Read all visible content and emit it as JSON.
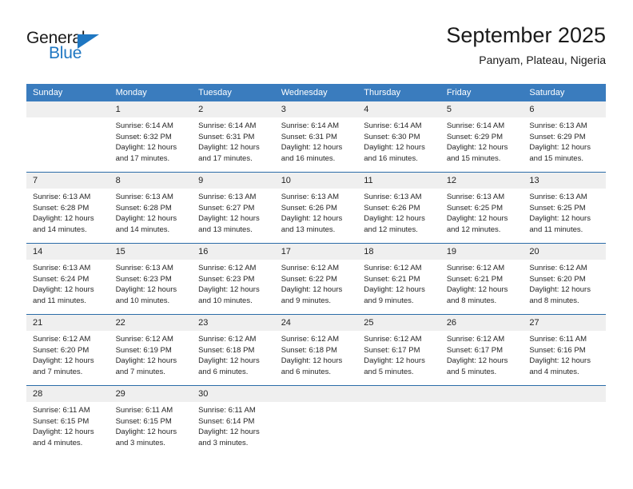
{
  "brand": {
    "name_part1": "General",
    "name_part2": "Blue"
  },
  "header": {
    "title": "September 2025",
    "location": "Panyam, Plateau, Nigeria"
  },
  "calendar": {
    "weekday_headers": [
      "Sunday",
      "Monday",
      "Tuesday",
      "Wednesday",
      "Thursday",
      "Friday",
      "Saturday"
    ],
    "accent_color": "#3a7cbe",
    "border_color": "#2b6ca8",
    "daynum_bg": "#efefef",
    "weeks": [
      [
        {
          "day": "",
          "sunrise": "",
          "sunset": "",
          "daylight1": "",
          "daylight2": ""
        },
        {
          "day": "1",
          "sunrise": "Sunrise: 6:14 AM",
          "sunset": "Sunset: 6:32 PM",
          "daylight1": "Daylight: 12 hours",
          "daylight2": "and 17 minutes."
        },
        {
          "day": "2",
          "sunrise": "Sunrise: 6:14 AM",
          "sunset": "Sunset: 6:31 PM",
          "daylight1": "Daylight: 12 hours",
          "daylight2": "and 17 minutes."
        },
        {
          "day": "3",
          "sunrise": "Sunrise: 6:14 AM",
          "sunset": "Sunset: 6:31 PM",
          "daylight1": "Daylight: 12 hours",
          "daylight2": "and 16 minutes."
        },
        {
          "day": "4",
          "sunrise": "Sunrise: 6:14 AM",
          "sunset": "Sunset: 6:30 PM",
          "daylight1": "Daylight: 12 hours",
          "daylight2": "and 16 minutes."
        },
        {
          "day": "5",
          "sunrise": "Sunrise: 6:14 AM",
          "sunset": "Sunset: 6:29 PM",
          "daylight1": "Daylight: 12 hours",
          "daylight2": "and 15 minutes."
        },
        {
          "day": "6",
          "sunrise": "Sunrise: 6:13 AM",
          "sunset": "Sunset: 6:29 PM",
          "daylight1": "Daylight: 12 hours",
          "daylight2": "and 15 minutes."
        }
      ],
      [
        {
          "day": "7",
          "sunrise": "Sunrise: 6:13 AM",
          "sunset": "Sunset: 6:28 PM",
          "daylight1": "Daylight: 12 hours",
          "daylight2": "and 14 minutes."
        },
        {
          "day": "8",
          "sunrise": "Sunrise: 6:13 AM",
          "sunset": "Sunset: 6:28 PM",
          "daylight1": "Daylight: 12 hours",
          "daylight2": "and 14 minutes."
        },
        {
          "day": "9",
          "sunrise": "Sunrise: 6:13 AM",
          "sunset": "Sunset: 6:27 PM",
          "daylight1": "Daylight: 12 hours",
          "daylight2": "and 13 minutes."
        },
        {
          "day": "10",
          "sunrise": "Sunrise: 6:13 AM",
          "sunset": "Sunset: 6:26 PM",
          "daylight1": "Daylight: 12 hours",
          "daylight2": "and 13 minutes."
        },
        {
          "day": "11",
          "sunrise": "Sunrise: 6:13 AM",
          "sunset": "Sunset: 6:26 PM",
          "daylight1": "Daylight: 12 hours",
          "daylight2": "and 12 minutes."
        },
        {
          "day": "12",
          "sunrise": "Sunrise: 6:13 AM",
          "sunset": "Sunset: 6:25 PM",
          "daylight1": "Daylight: 12 hours",
          "daylight2": "and 12 minutes."
        },
        {
          "day": "13",
          "sunrise": "Sunrise: 6:13 AM",
          "sunset": "Sunset: 6:25 PM",
          "daylight1": "Daylight: 12 hours",
          "daylight2": "and 11 minutes."
        }
      ],
      [
        {
          "day": "14",
          "sunrise": "Sunrise: 6:13 AM",
          "sunset": "Sunset: 6:24 PM",
          "daylight1": "Daylight: 12 hours",
          "daylight2": "and 11 minutes."
        },
        {
          "day": "15",
          "sunrise": "Sunrise: 6:13 AM",
          "sunset": "Sunset: 6:23 PM",
          "daylight1": "Daylight: 12 hours",
          "daylight2": "and 10 minutes."
        },
        {
          "day": "16",
          "sunrise": "Sunrise: 6:12 AM",
          "sunset": "Sunset: 6:23 PM",
          "daylight1": "Daylight: 12 hours",
          "daylight2": "and 10 minutes."
        },
        {
          "day": "17",
          "sunrise": "Sunrise: 6:12 AM",
          "sunset": "Sunset: 6:22 PM",
          "daylight1": "Daylight: 12 hours",
          "daylight2": "and 9 minutes."
        },
        {
          "day": "18",
          "sunrise": "Sunrise: 6:12 AM",
          "sunset": "Sunset: 6:21 PM",
          "daylight1": "Daylight: 12 hours",
          "daylight2": "and 9 minutes."
        },
        {
          "day": "19",
          "sunrise": "Sunrise: 6:12 AM",
          "sunset": "Sunset: 6:21 PM",
          "daylight1": "Daylight: 12 hours",
          "daylight2": "and 8 minutes."
        },
        {
          "day": "20",
          "sunrise": "Sunrise: 6:12 AM",
          "sunset": "Sunset: 6:20 PM",
          "daylight1": "Daylight: 12 hours",
          "daylight2": "and 8 minutes."
        }
      ],
      [
        {
          "day": "21",
          "sunrise": "Sunrise: 6:12 AM",
          "sunset": "Sunset: 6:20 PM",
          "daylight1": "Daylight: 12 hours",
          "daylight2": "and 7 minutes."
        },
        {
          "day": "22",
          "sunrise": "Sunrise: 6:12 AM",
          "sunset": "Sunset: 6:19 PM",
          "daylight1": "Daylight: 12 hours",
          "daylight2": "and 7 minutes."
        },
        {
          "day": "23",
          "sunrise": "Sunrise: 6:12 AM",
          "sunset": "Sunset: 6:18 PM",
          "daylight1": "Daylight: 12 hours",
          "daylight2": "and 6 minutes."
        },
        {
          "day": "24",
          "sunrise": "Sunrise: 6:12 AM",
          "sunset": "Sunset: 6:18 PM",
          "daylight1": "Daylight: 12 hours",
          "daylight2": "and 6 minutes."
        },
        {
          "day": "25",
          "sunrise": "Sunrise: 6:12 AM",
          "sunset": "Sunset: 6:17 PM",
          "daylight1": "Daylight: 12 hours",
          "daylight2": "and 5 minutes."
        },
        {
          "day": "26",
          "sunrise": "Sunrise: 6:12 AM",
          "sunset": "Sunset: 6:17 PM",
          "daylight1": "Daylight: 12 hours",
          "daylight2": "and 5 minutes."
        },
        {
          "day": "27",
          "sunrise": "Sunrise: 6:11 AM",
          "sunset": "Sunset: 6:16 PM",
          "daylight1": "Daylight: 12 hours",
          "daylight2": "and 4 minutes."
        }
      ],
      [
        {
          "day": "28",
          "sunrise": "Sunrise: 6:11 AM",
          "sunset": "Sunset: 6:15 PM",
          "daylight1": "Daylight: 12 hours",
          "daylight2": "and 4 minutes."
        },
        {
          "day": "29",
          "sunrise": "Sunrise: 6:11 AM",
          "sunset": "Sunset: 6:15 PM",
          "daylight1": "Daylight: 12 hours",
          "daylight2": "and 3 minutes."
        },
        {
          "day": "30",
          "sunrise": "Sunrise: 6:11 AM",
          "sunset": "Sunset: 6:14 PM",
          "daylight1": "Daylight: 12 hours",
          "daylight2": "and 3 minutes."
        },
        {
          "day": "",
          "sunrise": "",
          "sunset": "",
          "daylight1": "",
          "daylight2": ""
        },
        {
          "day": "",
          "sunrise": "",
          "sunset": "",
          "daylight1": "",
          "daylight2": ""
        },
        {
          "day": "",
          "sunrise": "",
          "sunset": "",
          "daylight1": "",
          "daylight2": ""
        },
        {
          "day": "",
          "sunrise": "",
          "sunset": "",
          "daylight1": "",
          "daylight2": ""
        }
      ]
    ]
  }
}
